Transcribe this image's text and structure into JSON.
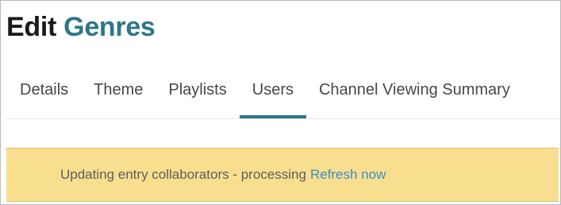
{
  "header": {
    "title_prefix": "Edit",
    "entity_name": "Genres"
  },
  "tabs": [
    {
      "label": "Details",
      "active": false
    },
    {
      "label": "Theme",
      "active": false
    },
    {
      "label": "Playlists",
      "active": false
    },
    {
      "label": "Users",
      "active": true
    },
    {
      "label": "Channel Viewing Summary",
      "active": false
    }
  ],
  "alert": {
    "message": "Updating entry collaborators - processing",
    "link_label": "Refresh now"
  },
  "colors": {
    "accent": "#2e7687",
    "alert_background": "#f7df8f",
    "link": "#3e8fc8"
  }
}
